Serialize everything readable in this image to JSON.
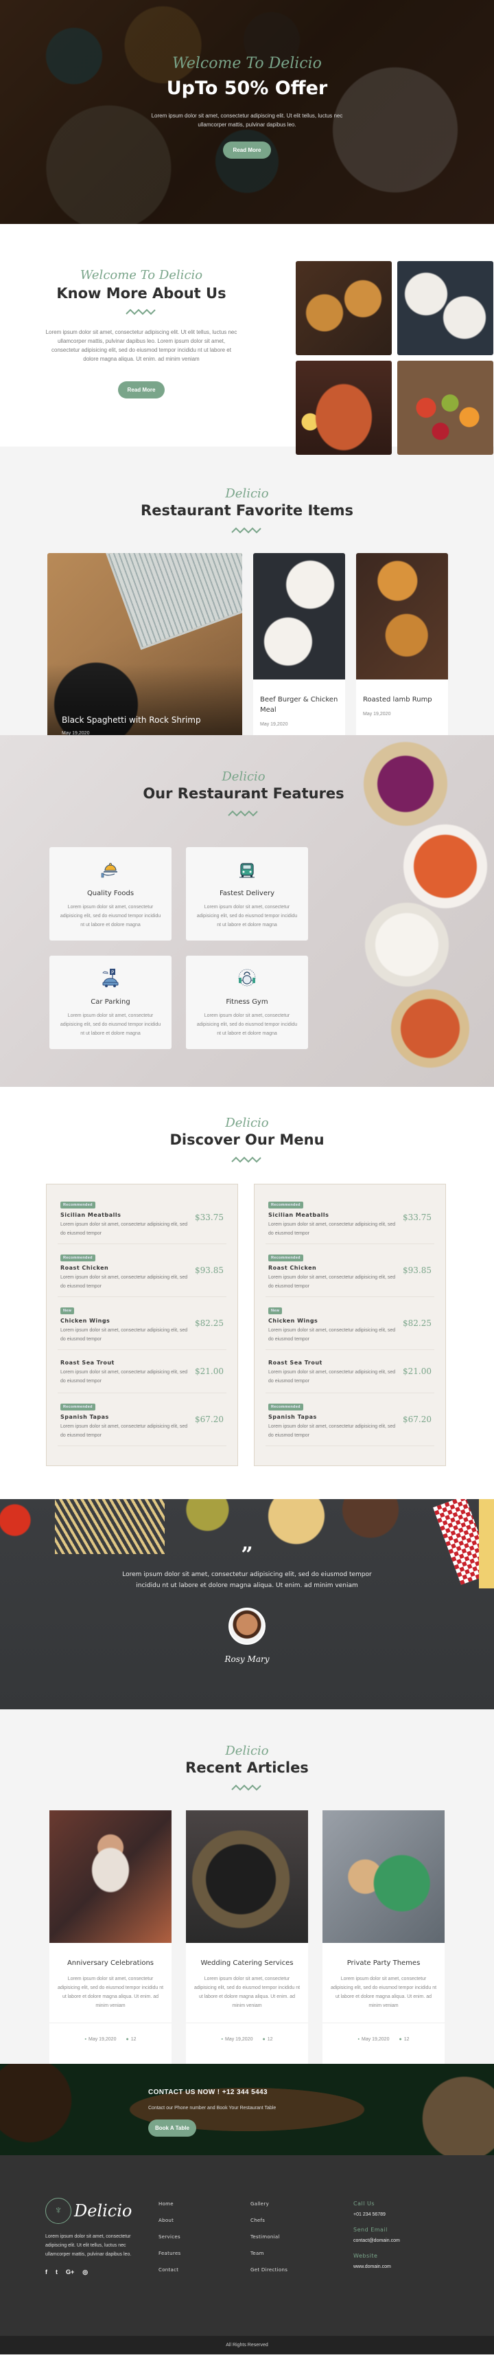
{
  "colors": {
    "accent": "#7aa58a",
    "dark": "#2e2e2e",
    "footer_bg": "#333333",
    "copyright_bg": "#232323"
  },
  "hero": {
    "script_title": "Welcome To Delicio",
    "title": "UpTo 50% Offer",
    "text": "Lorem ipsum dolor sit amet, consectetur adipiscing elit. Ut elit tellus, luctus nec ullamcorper mattis, pulvinar dapibus leo.",
    "button": "Read More"
  },
  "about": {
    "script_title": "Welcome To Delicio",
    "title": "Know More About Us",
    "text": "Lorem ipsum dolor sit amet, consectetur adipiscing elit. Ut elit tellus, luctus nec ullamcorper mattis, pulvinar dapibus leo. Lorem ipsum dolor sit amet, consectetur adipisicing elit, sed do eiusmod tempor incididu nt ut labore et dolore magna aliqua. Ut enim. ad minim veniam",
    "button": "Read More",
    "gallery": [
      "bagels-photo",
      "breakfast-plates-photo",
      "crayfish-photo",
      "fruits-photo"
    ]
  },
  "favorites": {
    "script_title": "Delicio",
    "title": "Restaurant Favorite Items",
    "featured": {
      "title": "Black Spaghetti with Rock Shrimp",
      "date": "May 19,2020"
    },
    "items": [
      {
        "title": "Beef Burger & Chicken Meal",
        "date": "May 19,2020"
      },
      {
        "title": "Roasted lamb Rump",
        "date": "May 19,2020"
      }
    ]
  },
  "features": {
    "script_title": "Delicio",
    "title": "Our Restaurant Features",
    "items": [
      {
        "icon": "food-tray-icon",
        "title": "Quality Foods",
        "text": "Lorem ipsum dolor sit amet, consectetur adipisicing elit, sed do eiusmod tempor incididu nt ut labore et dolore magna"
      },
      {
        "icon": "delivery-car-icon",
        "title": "Fastest Delivery",
        "text": "Lorem ipsum dolor sit amet, consectetur adipisicing elit, sed do eiusmod tempor incididu nt ut labore et dolore magna"
      },
      {
        "icon": "parking-icon",
        "title": "Car Parking",
        "text": "Lorem ipsum dolor sit amet, consectetur adipisicing elit, sed do eiusmod tempor incididu nt ut labore et dolore magna"
      },
      {
        "icon": "kettlebell-icon",
        "title": "Fitness Gym",
        "text": "Lorem ipsum dolor sit amet, consectetur adipisicing elit, sed do eiusmod tempor incididu nt ut labore et dolore magna"
      }
    ]
  },
  "menu": {
    "script_title": "Delicio",
    "title": "Discover Our Menu",
    "columns": [
      {
        "items": [
          {
            "badge": "Recommended",
            "name": "Sicilian Meatballs",
            "desc": "Lorem ipsum dolor sit amet, consectetur adipisicing elit, sed do eiusmod tempor",
            "price": "$33.75"
          },
          {
            "badge": "Recommended",
            "name": "Roast Chicken",
            "desc": "Lorem ipsum dolor sit amet, consectetur adipisicing elit, sed do eiusmod tempor",
            "price": "$93.85"
          },
          {
            "badge": "New",
            "name": "Chicken Wings",
            "desc": "Lorem ipsum dolor sit amet, consectetur adipisicing elit, sed do eiusmod tempor",
            "price": "$82.25"
          },
          {
            "badge": "",
            "name": "Roast Sea Trout",
            "desc": "Lorem ipsum dolor sit amet, consectetur adipisicing elit, sed do eiusmod tempor",
            "price": "$21.00"
          },
          {
            "badge": "Recommended",
            "name": "Spanish Tapas",
            "desc": "Lorem ipsum dolor sit amet, consectetur adipisicing elit, sed do eiusmod tempor",
            "price": "$67.20"
          }
        ]
      },
      {
        "items": [
          {
            "badge": "Recommended",
            "name": "Sicilian Meatballs",
            "desc": "Lorem ipsum dolor sit amet, consectetur adipisicing elit, sed do eiusmod tempor",
            "price": "$33.75"
          },
          {
            "badge": "Recommended",
            "name": "Roast Chicken",
            "desc": "Lorem ipsum dolor sit amet, consectetur adipisicing elit, sed do eiusmod tempor",
            "price": "$93.85"
          },
          {
            "badge": "New",
            "name": "Chicken Wings",
            "desc": "Lorem ipsum dolor sit amet, consectetur adipisicing elit, sed do eiusmod tempor",
            "price": "$82.25"
          },
          {
            "badge": "",
            "name": "Roast Sea Trout",
            "desc": "Lorem ipsum dolor sit amet, consectetur adipisicing elit, sed do eiusmod tempor",
            "price": "$21.00"
          },
          {
            "badge": "Recommended",
            "name": "Spanish Tapas",
            "desc": "Lorem ipsum dolor sit amet, consectetur adipisicing elit, sed do eiusmod tempor",
            "price": "$67.20"
          }
        ]
      }
    ]
  },
  "testimonial": {
    "quote_mark": "”",
    "text": "Lorem ipsum dolor sit amet, consectetur adipisicing elit, sed do eiusmod tempor incididu nt ut labore et dolore magna aliqua. Ut enim. ad minim veniam",
    "name": "Rosy Mary"
  },
  "articles": {
    "script_title": "Delicio",
    "title": "Recent Articles",
    "items": [
      {
        "title": "Anniversary Celebrations",
        "text": "Lorem ipsum dolor sit amet, consectetur adipisicing elit, sed do eiusmod tempor incididu nt ut labore et dolore magna aliqua. Ut enim. ad minim veniam",
        "date": "May 19,2020",
        "comments": "12"
      },
      {
        "title": "Wedding Catering Services",
        "text": "Lorem ipsum dolor sit amet, consectetur adipisicing elit, sed do eiusmod tempor incididu nt ut labore et dolore magna aliqua. Ut enim. ad minim veniam",
        "date": "May 19,2020",
        "comments": "12"
      },
      {
        "title": "Private Party Themes",
        "text": "Lorem ipsum dolor sit amet, consectetur adipisicing elit, sed do eiusmod tempor incididu nt ut labore et dolore magna aliqua. Ut enim. ad minim veniam",
        "date": "May 19,2020",
        "comments": "12"
      }
    ]
  },
  "contact_banner": {
    "title": "CONTACT US NOW ! +12 344 5443",
    "text": "Contact our Phone number and Book Your Restaurant Table",
    "button": "Book A Table"
  },
  "footer": {
    "logo_text": "Delicio",
    "about": "Lorem ipsum dolor sit amet, consectetur adipiscing elit. Ut elit tellus, luctus nec ullamcorper mattis, pulvinar dapibus leo.",
    "social": [
      {
        "icon": "facebook-icon",
        "glyph": "f"
      },
      {
        "icon": "twitter-icon",
        "glyph": "t"
      },
      {
        "icon": "google-plus-icon",
        "glyph": "G+"
      },
      {
        "icon": "instagram-icon",
        "glyph": "◎"
      }
    ],
    "links_1": [
      "Home",
      "About",
      "Services",
      "Features",
      "Contact"
    ],
    "links_2": [
      "Gallery",
      "Chefs",
      "Testimonial",
      "Team",
      "Get Directions"
    ],
    "contact": [
      {
        "label": "Call Us",
        "value": "+01 234 56789"
      },
      {
        "label": "Send Email",
        "value": "contact@domain.com"
      },
      {
        "label": "Website",
        "value": "www.domain.com"
      }
    ],
    "copyright": "All Rights Reserved"
  }
}
